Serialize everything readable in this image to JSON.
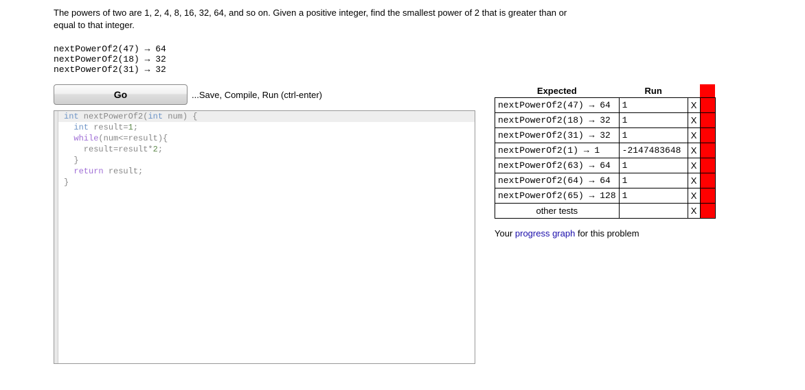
{
  "problem": {
    "description": "The powers of two are 1, 2, 4, 8, 16, 32, 64, and so on. Given a positive integer, find the smallest power of 2 that is greater than or equal to that integer.",
    "examples": "nextPowerOf2(47) → 64\nnextPowerOf2(18) → 32\nnextPowerOf2(31) → 32"
  },
  "controls": {
    "go_label": "Go",
    "go_hint": "...Save, Compile, Run (ctrl-enter)"
  },
  "editor": {
    "lines": [
      "int nextPowerOf2(int num) {",
      "  int result=1;",
      "  while(num<=result){",
      "    result=result*2;",
      "  }",
      "  return result;",
      "}"
    ]
  },
  "results": {
    "headers": {
      "expected": "Expected",
      "run": "Run"
    },
    "rows": [
      {
        "expected": "nextPowerOf2(47) → 64",
        "run": "1",
        "mark": "X",
        "status": "fail"
      },
      {
        "expected": "nextPowerOf2(18) → 32",
        "run": "1",
        "mark": "X",
        "status": "fail"
      },
      {
        "expected": "nextPowerOf2(31) → 32",
        "run": "1",
        "mark": "X",
        "status": "fail"
      },
      {
        "expected": "nextPowerOf2(1) → 1",
        "run": "-2147483648",
        "mark": "X",
        "status": "fail"
      },
      {
        "expected": "nextPowerOf2(63) → 64",
        "run": "1",
        "mark": "X",
        "status": "fail"
      },
      {
        "expected": "nextPowerOf2(64) → 64",
        "run": "1",
        "mark": "X",
        "status": "fail"
      },
      {
        "expected": "nextPowerOf2(65) → 128",
        "run": "1",
        "mark": "X",
        "status": "fail"
      }
    ],
    "other": {
      "label": "other tests",
      "mark": "X",
      "status": "fail"
    }
  },
  "progress": {
    "prefix": "Your ",
    "link_text": "progress graph",
    "suffix": " for this problem"
  },
  "colors": {
    "fail": "#ff0000"
  }
}
